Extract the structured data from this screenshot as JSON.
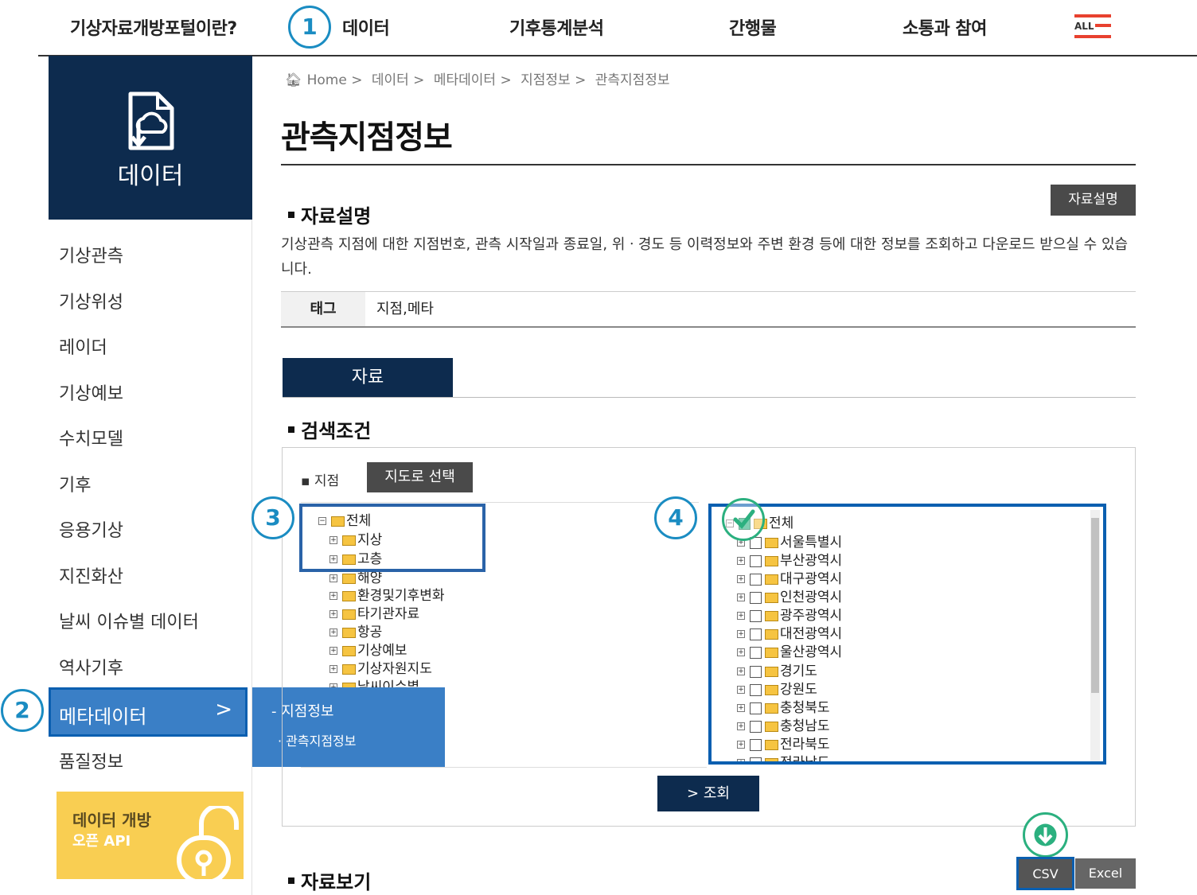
{
  "topnav": {
    "items": [
      "기상자료개방포털이란?",
      "데이터",
      "기후통계분석",
      "간행물",
      "소통과 참여"
    ],
    "all_label": "ALL"
  },
  "badges": [
    "1",
    "2",
    "3",
    "4"
  ],
  "sidebar": {
    "header": "데이터",
    "items": [
      "기상관측",
      "기상위성",
      "레이더",
      "기상예보",
      "수치모델",
      "기후",
      "응용기상",
      "지진화산",
      "날씨 이슈별 데이터",
      "역사기후",
      "메타데이터",
      "품질정보"
    ],
    "active_chevron": ">",
    "submenu": [
      "- 지점정보",
      "· 관측지점정보"
    ],
    "openapi": [
      "데이터 개방",
      "오픈 API"
    ]
  },
  "breadcrumb": [
    "Home >",
    "데이터 >",
    "메타데이터 >",
    "지점정보 >",
    "관측지점정보"
  ],
  "page_title": "관측지점정보",
  "section_desc": {
    "title": "자료설명",
    "button": "자료설명",
    "text": "기상관측 지점에 대한 지점번호, 관측 시작일과 종료일, 위ㆍ경도 등 이력정보와 주변 환경 등에 대한 정보를 조회하고 다운로드 받으실 수 있습니다.",
    "tag_label": "태그",
    "tag_value": "지점,메타"
  },
  "tab": "자료",
  "search": {
    "title": "검색조건",
    "station_label": "▪ 지점",
    "map_button": "지도로 선택",
    "left_tree": [
      "전체",
      "지상",
      "고층",
      "해양",
      "환경및기후변화",
      "타기관자료",
      "항공",
      "기상예보",
      "기상자원지도",
      "날씨이슈별"
    ],
    "right_tree": [
      "전체",
      "서울특별시",
      "부산광역시",
      "대구광역시",
      "인천광역시",
      "광주광역시",
      "대전광역시",
      "울산광역시",
      "경기도",
      "강원도",
      "충청북도",
      "충청남도",
      "전라북도",
      "전라남도"
    ],
    "query_button": "> 조회"
  },
  "view": {
    "title": "자료보기",
    "csv": "CSV",
    "excel": "Excel"
  }
}
